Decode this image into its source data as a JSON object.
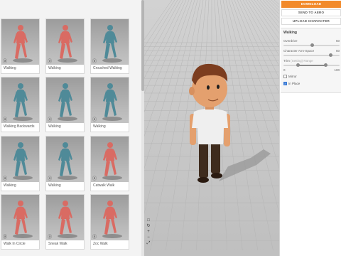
{
  "animations": [
    {
      "label": "Walking",
      "color": "#d96b63"
    },
    {
      "label": "Walking",
      "color": "#d96b63"
    },
    {
      "label": "Crouched Walking",
      "color": "#4f8a98"
    },
    {
      "label": "Walking Backwards",
      "color": "#4f8a98"
    },
    {
      "label": "Walking",
      "color": "#4f8a98"
    },
    {
      "label": "Walking",
      "color": "#4f8a98"
    },
    {
      "label": "Walking",
      "color": "#4f8a98"
    },
    {
      "label": "Walking",
      "color": "#4f8a98"
    },
    {
      "label": "Catwalk Walk",
      "color": "#d96b63"
    },
    {
      "label": "Walk In Circle",
      "color": "#d96b63"
    },
    {
      "label": "Sneak Walk",
      "color": "#d96b63"
    },
    {
      "label": "Zoc Walk",
      "color": "#d96b63"
    }
  ],
  "panel": {
    "download_label": "DOWNLOAD",
    "send_label": "SEND TO AERO",
    "upload_label": "UPLOAD CHARACTER",
    "animation_name": "Walking",
    "overdrive": {
      "label": "Overdrive",
      "value": "50",
      "fraction": 0.5
    },
    "arm_space": {
      "label": "Character Arm-Space",
      "value": "50",
      "fraction": 0.84
    },
    "trim": {
      "label": "Trim",
      "hint": "(Setting) Range",
      "min": "0",
      "max": "100",
      "start_fraction": 0.25,
      "end_fraction": 0.75
    },
    "mirror": {
      "label": "Mirror",
      "checked": false
    },
    "in_place": {
      "label": "In Place",
      "checked": true
    }
  },
  "viewport": {
    "tool_icons": [
      "□",
      "↻",
      "+",
      "−",
      "⤢"
    ],
    "floor_color": "#c6c6c6",
    "shirt_color": "#efefef",
    "pants_color": "#3e2b1d",
    "skin_color": "#e4a06e",
    "hair_color": "#7c3d1f"
  }
}
